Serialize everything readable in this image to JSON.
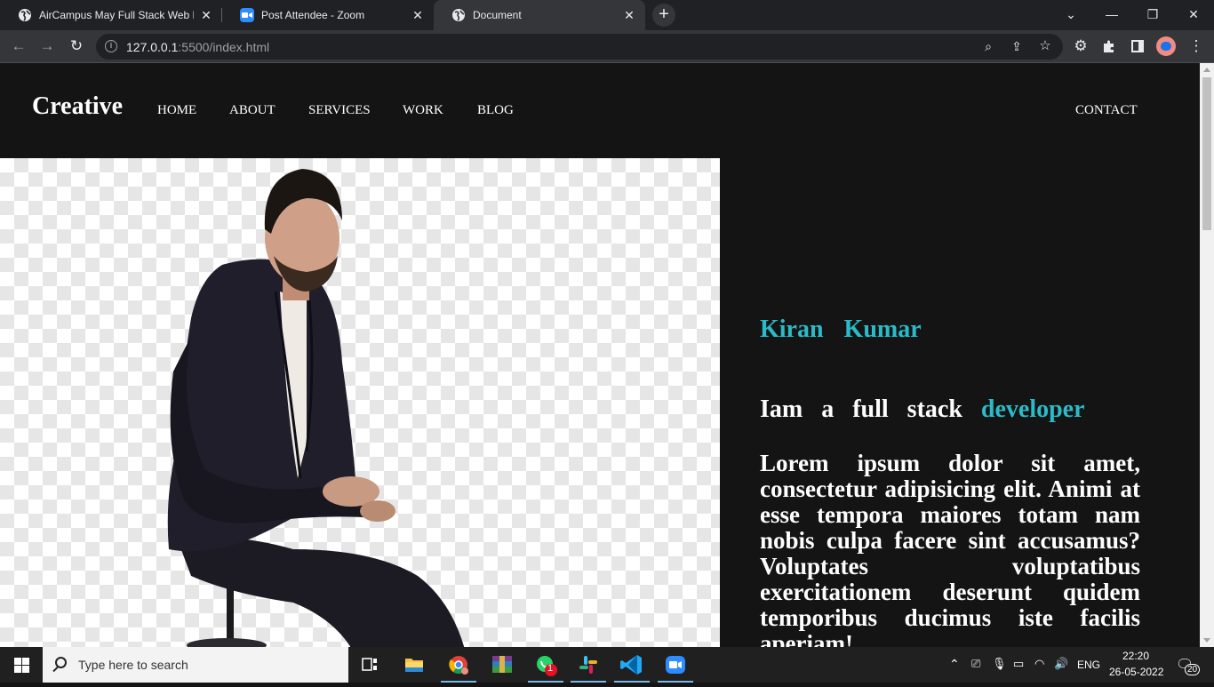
{
  "browser": {
    "tabs": [
      {
        "title": "AirCampus May Full Stack Web D",
        "icon": "globe-icon"
      },
      {
        "title": "Post Attendee - Zoom",
        "icon": "zoom-icon"
      },
      {
        "title": "Document",
        "icon": "globe-icon",
        "active": true
      }
    ],
    "url_host": "127.0.0.1",
    "url_rest": ":5500/index.html"
  },
  "page": {
    "brand": "Creative",
    "nav": [
      "HOME",
      "ABOUT",
      "SERVICES",
      "WORK",
      "BLOG"
    ],
    "contact": "CONTACT",
    "name": "Kiran  Kumar",
    "tagline_prefix": "Iam a full stack ",
    "tagline_accent": "developer",
    "paragraph": "Lorem ipsum dolor sit amet, consectetur adipisicing elit. Animi at esse tempora maiores totam nam nobis culpa facere sint accusamus? Voluptates voluptatibus exercitationem deserunt quidem temporibus ducimus iste facilis aperiam!",
    "colors": {
      "accent": "#2bbbc8",
      "background": "#141414"
    }
  },
  "taskbar": {
    "search_placeholder": "Type here to search",
    "language": "ENG",
    "time": "22:20",
    "date": "26-05-2022",
    "notifications": "20",
    "whatsapp_badge": "1"
  }
}
